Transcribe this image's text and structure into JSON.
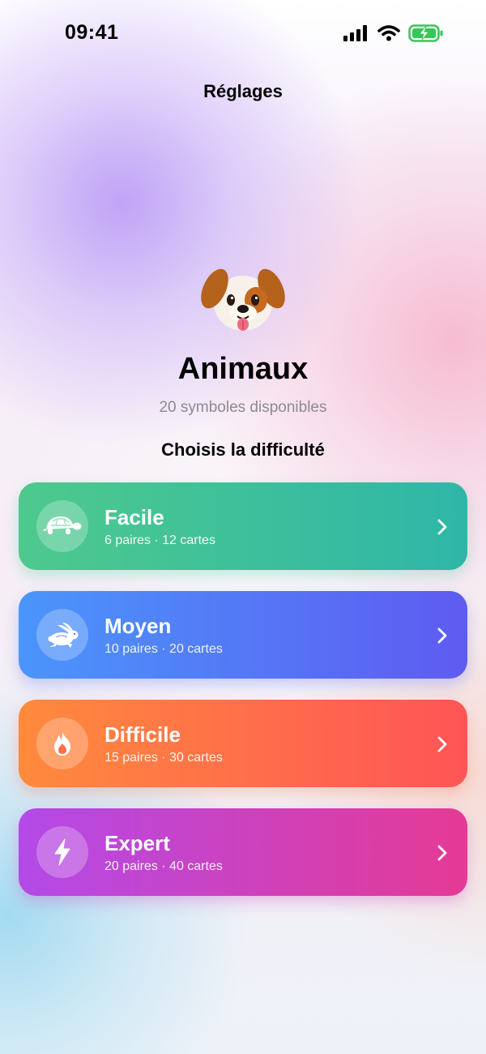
{
  "status_bar": {
    "time": "09:41",
    "icons": [
      "cellular-signal-icon",
      "wifi-icon",
      "battery-charging-icon"
    ],
    "battery_color": "#34c759"
  },
  "nav": {
    "title": "Réglages"
  },
  "header": {
    "emoji": "dog-face",
    "title": "Animaux",
    "subtitle": "20 symboles disponibles",
    "prompt": "Choisis la difficulté"
  },
  "difficulties": [
    {
      "label": "Facile",
      "detail": "6 paires · 12 cartes",
      "icon": "turtle-icon",
      "gradient": [
        "#4ec98d",
        "#2fb6a8"
      ]
    },
    {
      "label": "Moyen",
      "detail": "10 paires · 20 cartes",
      "icon": "hare-icon",
      "gradient": [
        "#4a95fb",
        "#5e5bf1"
      ]
    },
    {
      "label": "Difficile",
      "detail": "15 paires · 30 cartes",
      "icon": "flame-icon",
      "gradient": [
        "#ff8a3c",
        "#ff5457"
      ]
    },
    {
      "label": "Expert",
      "detail": "20 paires · 40 cartes",
      "icon": "bolt-icon",
      "gradient": [
        "#b34ae8",
        "#e53a95"
      ]
    }
  ]
}
